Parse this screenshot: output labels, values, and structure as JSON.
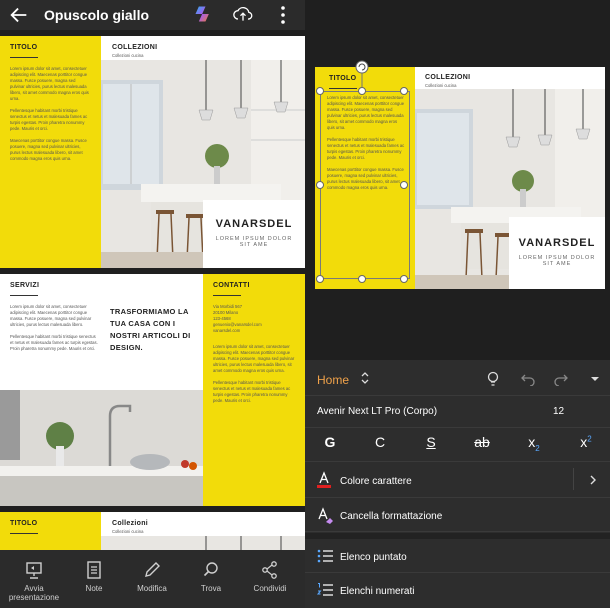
{
  "app": {
    "doc_title": "Opuscolo giallo"
  },
  "brochure": {
    "page1": {
      "left_title": "TITOLO",
      "left_body": "Lorem ipsum dolor sit amet, consectetuer adipiscing elit. Maecenas porttitor congue massa. Fusce posuere, magna sed pulvinar ultricies, purus lectus malesuada libero, sit amet commodo magna eros quis urna.",
      "left_body2": "Pellentesque habitant morbi tristique senectus et netus et malesuada fames ac turpis egestas. Proin pharetra nonummy pede. Mauris et orci.",
      "left_body3": "Maecenas porttitor congue massa. Fusce posuere, magna sed pulvinar ultricies, purus lectus malesuada libero, sit amet commodo magna eros quis urna.",
      "right_title": "COLLEZIONI",
      "right_sub": "Collezioni cucina",
      "brand": "VANARSDEL",
      "brand_sub": "LOREM IPSUM DOLOR SIT AME"
    },
    "page2": {
      "servizi_title": "SERVIZI",
      "servizi_body": "Lorem ipsum dolor sit amet, consectetuer adipiscing elit. Maecenas porttitor congue massa. Fusce posuere, magna sed pulvinar ultricies, purus lectus malesuada libero.",
      "servizi_body2": "Pellentesque habitant morbi tristique senectus et netus et malesuada fames ac turpis egestas. Proin pharetra nonummy pede. Mauris et orci.",
      "tagline": "TRASFORMIAMO LA TUA CASA CON I NOSTRI ARTICOLI DI DESIGN.",
      "contatti_title": "CONTATTI",
      "contatti_lines": [
        "Via Morbidi 567",
        "20100 Milano",
        "123-4568",
        "genuenio@vanarsdel.com",
        "vanarsdel.com"
      ],
      "contatti_body": "Lorem ipsum dolor sit amet, consectetuer adipiscing elit. Maecenas porttitor congue massa. Fusce posuere, magna sed pulvinar ultricies, purus lectus malesuada libero, sit amet commodo magna eros quis urna.",
      "contatti_body2": "Pellentesque habitant morbi tristique senectus et netus et malesuada fames ac turpis egestas. Proin pharetra nonummy pede. Mauris et orci."
    },
    "page3": {
      "left_title": "TITOLO",
      "right_title": "Collezioni",
      "right_sub": "Collezioni cucina"
    }
  },
  "bottom_nav": {
    "present": "Avvia presentazione",
    "notes": "Note",
    "edit": "Modifica",
    "find": "Trova",
    "share": "Condividi"
  },
  "right_doc": {
    "left_title": "TITOLO",
    "right_title": "COLLEZIONI",
    "right_sub": "Collezioni cucina",
    "body": "Lorem ipsum dolor sit amet, consectetuer adipiscing elit. Maecenas porttitor congue massa. Fusce posuere, magna sed pulvinar ultricies, purus lectus malesuada libero, sit amet commodo magna eros quis urna.",
    "body2": "Pellentesque habitant morbi tristique senectus et netus et malesuada fames ac turpis egestas. Proin pharetra nonummy pede. Mauris et orci.",
    "body3": "Maecenas porttitor congue massa. Fusce posuere, magna sed pulvinar ultricies, purus lectus malesuada libero, sit amet commodo magna eros quis urna.",
    "brand": "VANARSDEL",
    "brand_sub": "LOREM IPSUM DOLOR SIT AME"
  },
  "ribbon": {
    "tab": "Home",
    "font_name": "Avenir Next LT Pro (Corpo)",
    "font_size": "12",
    "bold": "G",
    "italic": "C",
    "underline": "S",
    "strike": "ab",
    "subscript_base": "x",
    "subscript_mark": "2",
    "superscript_base": "x",
    "superscript_mark": "2",
    "font_color": "Colore carattere",
    "clear_format": "Cancella formattazione",
    "bullets": "Elenco puntato",
    "numbering": "Elenchi numerati"
  },
  "colors": {
    "accent": "#f2dc0a",
    "home_tab": "#f0a24a",
    "font_color_bar": "#e02020"
  }
}
